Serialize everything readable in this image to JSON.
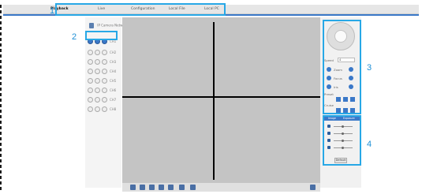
{
  "topbar": {
    "tabs": [
      {
        "label": "Playback",
        "active": true
      },
      {
        "label": "Live"
      },
      {
        "label": "Configuration"
      },
      {
        "label": "Local File"
      },
      {
        "label": "Local PC"
      }
    ]
  },
  "callouts": {
    "one": "1",
    "two": "2",
    "three": "3",
    "four": "4"
  },
  "left_panel": {
    "device_label": "IP Camera Network",
    "channels": [
      {
        "label": "CH1",
        "selected": true
      },
      {
        "label": "CH2"
      },
      {
        "label": "CH3"
      },
      {
        "label": "CH4"
      },
      {
        "label": "CH5"
      },
      {
        "label": "CH6"
      },
      {
        "label": "CH7"
      },
      {
        "label": "CH8"
      }
    ]
  },
  "ptz": {
    "speed_label": "Speed",
    "speed_value": "4",
    "zoom_label": "Zoom",
    "focus_label": "Focus",
    "iris_label": "Iris",
    "preset_label": "Preset",
    "cruise_label": "Cruise"
  },
  "image_panel": {
    "tab_1": "Image",
    "tab_2": "Exposure",
    "default_label": "Default"
  },
  "colors": {
    "accent": "#3a78c8",
    "callout": "#28a8e6",
    "video_bg": "#c4c4c4"
  }
}
